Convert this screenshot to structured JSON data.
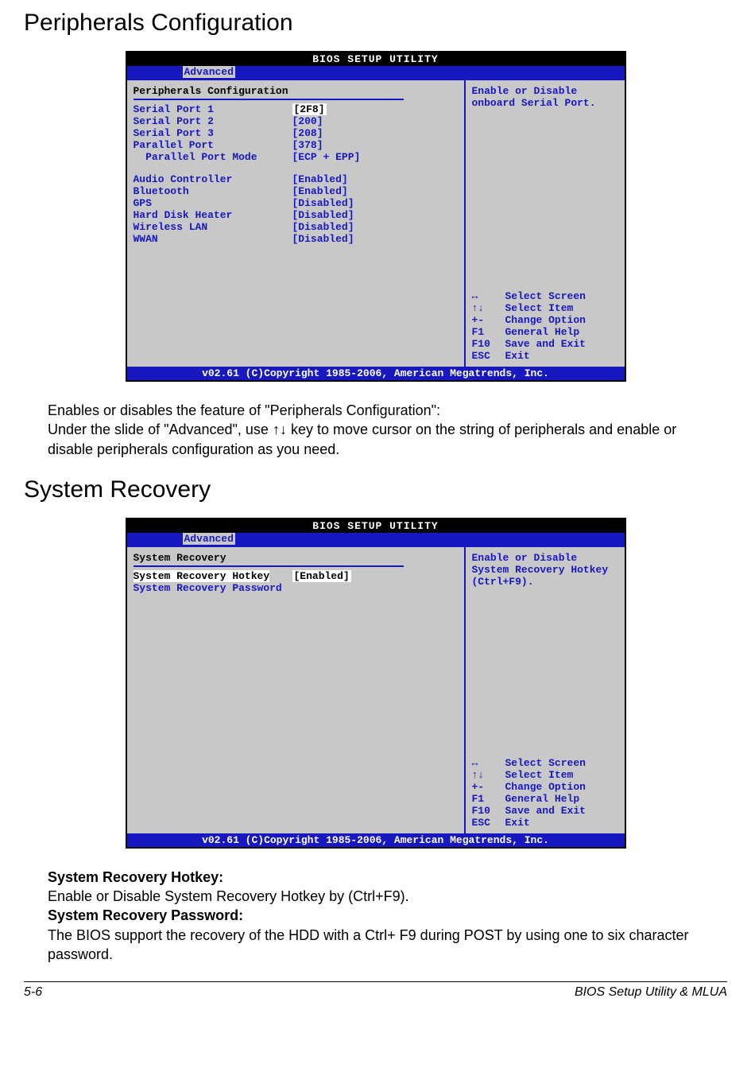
{
  "section1": {
    "heading": "Peripherals Configuration",
    "bios": {
      "title": "BIOS SETUP UTILITY",
      "tab": "Advanced",
      "panel_title": "Peripherals Configuration",
      "rows_a": [
        {
          "label": "Serial Port 1",
          "value": "[2F8]",
          "sel_label": false,
          "sel_value": true
        },
        {
          "label": "Serial Port 2",
          "value": "[200]"
        },
        {
          "label": "Serial Port 3",
          "value": "[208]"
        },
        {
          "label": "Parallel Port",
          "value": "[378]"
        },
        {
          "label": "  Parallel Port Mode",
          "value": "[ECP + EPP]"
        }
      ],
      "rows_b": [
        {
          "label": "Audio Controller",
          "value": "[Enabled]"
        },
        {
          "label": "Bluetooth",
          "value": "[Enabled]"
        },
        {
          "label": "GPS",
          "value": "[Disabled]"
        },
        {
          "label": "Hard Disk Heater",
          "value": "[Disabled]"
        },
        {
          "label": "Wireless LAN",
          "value": "[Disabled]"
        },
        {
          "label": "WWAN",
          "value": "[Disabled]"
        }
      ],
      "help": "Enable or Disable onboard Serial Port.",
      "keys": [
        {
          "k": "↔",
          "d": "Select Screen"
        },
        {
          "k": "↑↓",
          "d": "Select Item"
        },
        {
          "k": "+-",
          "d": "Change Option"
        },
        {
          "k": "F1",
          "d": "General Help"
        },
        {
          "k": "F10",
          "d": "Save and Exit"
        },
        {
          "k": "ESC",
          "d": "Exit"
        }
      ],
      "footer": "v02.61 (C)Copyright 1985-2006, American Megatrends, Inc."
    },
    "para1": "Enables or disables the feature of \"Peripherals Configuration\":",
    "para2a": "Under the slide of \"Advanced\", use ",
    "para2_arrows": "↑↓",
    "para2b": " key to move cursor on the string of peripherals and enable or disable peripherals configuration as you need."
  },
  "section2": {
    "heading": "System Recovery",
    "bios": {
      "title": "BIOS SETUP UTILITY",
      "tab": "Advanced",
      "panel_title": "System Recovery",
      "rows": [
        {
          "label": "System Recovery Hotkey",
          "value": "[Enabled]",
          "sel_label": true,
          "sel_value": true
        },
        {
          "label": "System Recovery Password",
          "value": ""
        }
      ],
      "help": "Enable or Disable System Recovery Hotkey (Ctrl+F9).",
      "keys": [
        {
          "k": "↔",
          "d": "Select Screen"
        },
        {
          "k": "↑↓",
          "d": "Select Item"
        },
        {
          "k": "+-",
          "d": "Change Option"
        },
        {
          "k": "F1",
          "d": "General Help"
        },
        {
          "k": "F10",
          "d": "Save and Exit"
        },
        {
          "k": "ESC",
          "d": "Exit"
        }
      ],
      "footer": "v02.61 (C)Copyright 1985-2006, American Megatrends, Inc."
    },
    "b1": "System Recovery Hotkey:",
    "p1": "Enable or Disable System Recovery Hotkey by (Ctrl+F9).",
    "b2": "System Recovery Password:",
    "p2": "The BIOS support the recovery of the HDD with a Ctrl+ F9 during POST by using one to six character password."
  },
  "footer": {
    "page": "5-6",
    "title": "BIOS Setup Utility & MLUA"
  }
}
